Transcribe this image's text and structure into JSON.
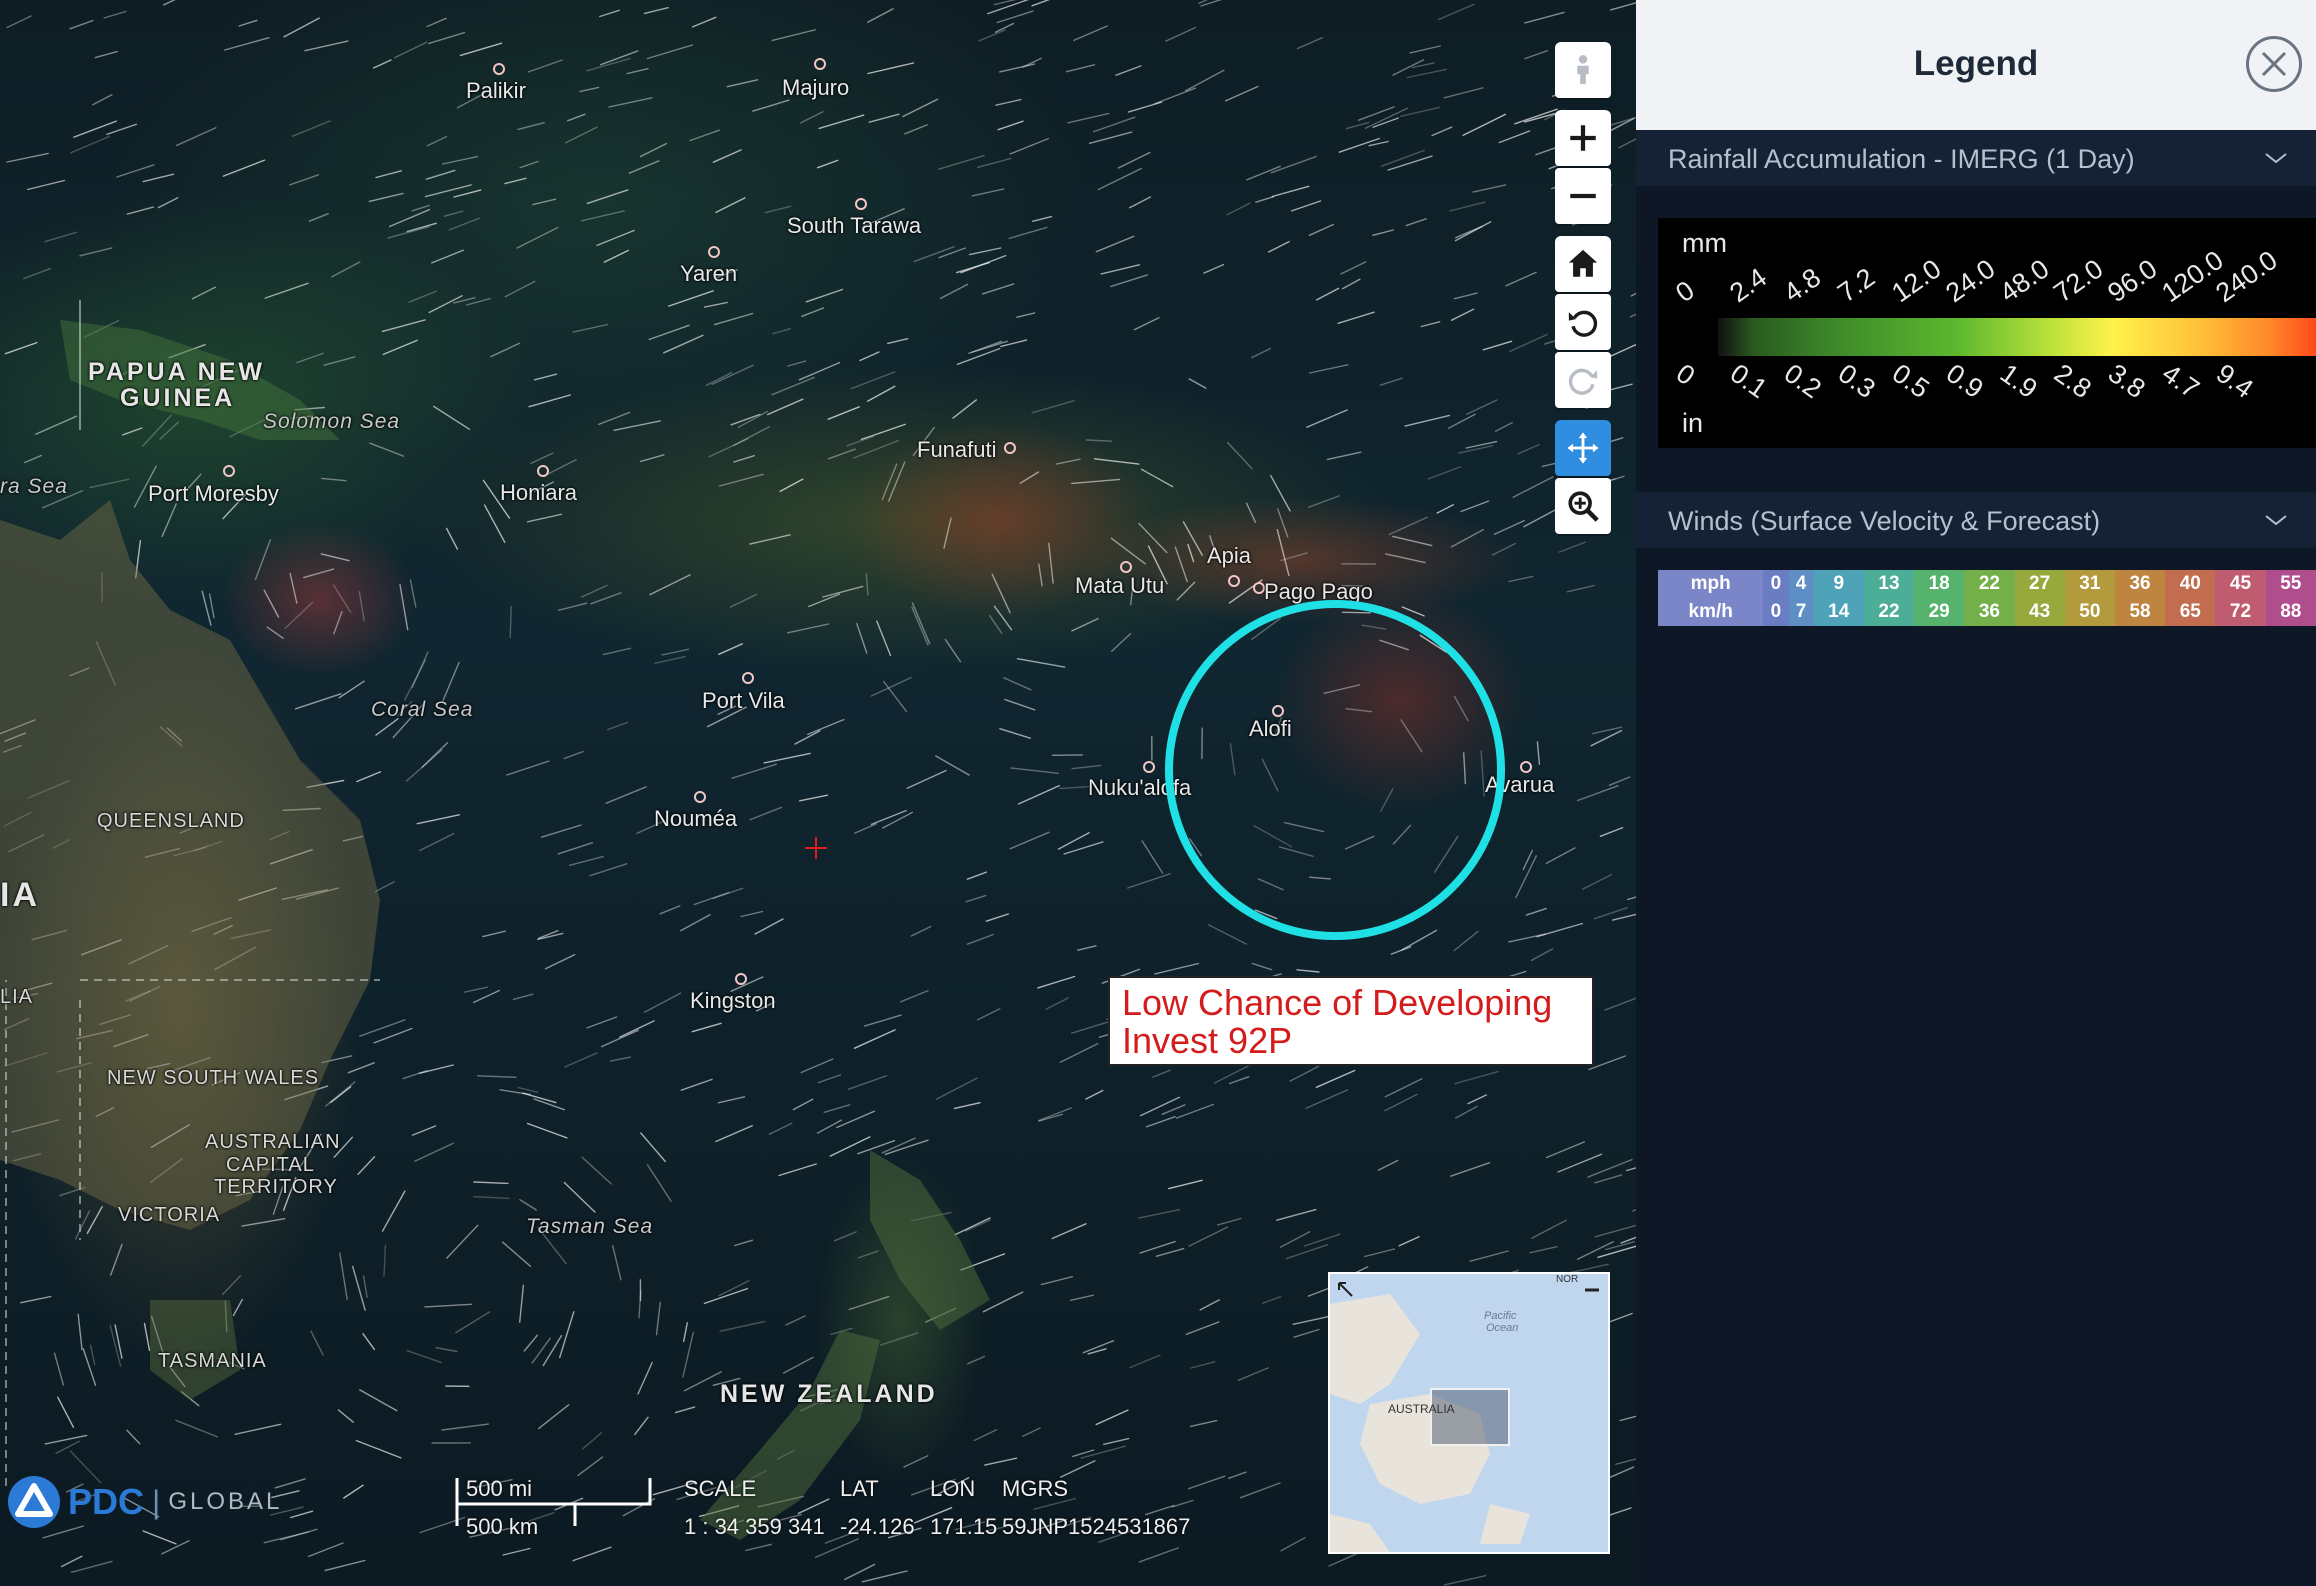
{
  "map": {
    "places": [
      {
        "id": "palikir",
        "label": "Palikir",
        "kind": "city"
      },
      {
        "id": "majuro",
        "label": "Majuro",
        "kind": "city"
      },
      {
        "id": "south-tarawa",
        "label": "South Tarawa",
        "kind": "city"
      },
      {
        "id": "yaren",
        "label": "Yaren",
        "kind": "city"
      },
      {
        "id": "papua",
        "label": "PAPUA NEW",
        "kind": "country"
      },
      {
        "id": "guinea",
        "label": "GUINEA",
        "kind": "country"
      },
      {
        "id": "solomon-sea",
        "label": "Solomon Sea",
        "kind": "sea"
      },
      {
        "id": "port-moresby",
        "label": "Port Moresby",
        "kind": "city"
      },
      {
        "id": "honiara",
        "label": "Honiara",
        "kind": "city"
      },
      {
        "id": "arafura-sea",
        "label": "ra Sea",
        "kind": "sea"
      },
      {
        "id": "funafuti",
        "label": "Funafuti",
        "kind": "city"
      },
      {
        "id": "apia",
        "label": "Apia",
        "kind": "city"
      },
      {
        "id": "mata-utu",
        "label": "Mata Utu",
        "kind": "city"
      },
      {
        "id": "pago-pago",
        "label": "Pago Pago",
        "kind": "city"
      },
      {
        "id": "coral-sea",
        "label": "Coral Sea",
        "kind": "sea"
      },
      {
        "id": "port-vila",
        "label": "Port Vila",
        "kind": "city"
      },
      {
        "id": "alofi",
        "label": "Alofi",
        "kind": "city"
      },
      {
        "id": "nukualofa",
        "label": "Nuku'alofa",
        "kind": "city"
      },
      {
        "id": "avarua",
        "label": "Avarua",
        "kind": "city"
      },
      {
        "id": "queensland",
        "label": "QUEENSLAND",
        "kind": "region"
      },
      {
        "id": "noumea",
        "label": "Nouméa",
        "kind": "city"
      },
      {
        "id": "australia-ia",
        "label": "IA",
        "kind": "country"
      },
      {
        "id": "australia-lia",
        "label": "LIA",
        "kind": "region"
      },
      {
        "id": "kingston",
        "label": "Kingston",
        "kind": "city"
      },
      {
        "id": "nsw",
        "label": "NEW SOUTH WALES",
        "kind": "region"
      },
      {
        "id": "act1",
        "label": "AUSTRALIAN",
        "kind": "region"
      },
      {
        "id": "act2",
        "label": "CAPITAL",
        "kind": "region"
      },
      {
        "id": "act3",
        "label": "TERRITORY",
        "kind": "region"
      },
      {
        "id": "victoria",
        "label": "VICTORIA",
        "kind": "region"
      },
      {
        "id": "tasman-sea",
        "label": "Tasman Sea",
        "kind": "sea"
      },
      {
        "id": "tasmania",
        "label": "TASMANIA",
        "kind": "region"
      },
      {
        "id": "new-zealand",
        "label": "NEW ZEALAND",
        "kind": "country"
      }
    ],
    "annotation": {
      "line1": "Low Chance of Developing",
      "line2": "Invest 92P"
    },
    "logo": {
      "brand": "PDC",
      "suffix": "GLOBAL"
    },
    "scale_bar": {
      "mi": "500 mi",
      "km": "500 km"
    },
    "readout": {
      "scale_label": "SCALE",
      "scale_value": "1 : 34 359 341",
      "lat_label": "LAT",
      "lat_value": "-24.126",
      "lon_label": "LON",
      "lon_value": "171.15",
      "mgrs_label": "MGRS",
      "mgrs_value": "59JNP1524531867"
    },
    "minimap": {
      "label": "AUSTRALIA",
      "ocean1": "Pacific",
      "ocean2": "Ocean",
      "corner": "NOR"
    }
  },
  "toolbar": {
    "icons": [
      "person-icon",
      "zoom-in-icon",
      "zoom-out-icon",
      "home-icon",
      "undo-icon",
      "redo-icon",
      "pan-icon",
      "zoom-box-icon"
    ]
  },
  "legend": {
    "title": "Legend",
    "rain": {
      "title": "Rainfall Accumulation - IMERG (1 Day)",
      "unit_top": "mm",
      "unit_bottom": "in",
      "mm_ticks": [
        "0",
        "2.4",
        "4.8",
        "7.2",
        "12.0",
        "24.0",
        "48.0",
        "72.0",
        "96.0",
        "120.0",
        "240.0"
      ],
      "in_ticks": [
        "0",
        "0.1",
        "0.2",
        "0.3",
        "0.5",
        "0.9",
        "1.9",
        "2.8",
        "3.8",
        "4.7",
        "9.4"
      ]
    },
    "winds": {
      "title": "Winds (Surface Velocity & Forecast)",
      "mph_label": "mph",
      "kmh_label": "km/h",
      "mph": [
        "0",
        "4",
        "9",
        "13",
        "18",
        "22",
        "27",
        "31",
        "36",
        "40",
        "45",
        "55"
      ],
      "kmh": [
        "0",
        "7",
        "14",
        "22",
        "29",
        "36",
        "43",
        "50",
        "58",
        "65",
        "72",
        "88"
      ],
      "colors": [
        "#6a7cc4",
        "#5d8fc4",
        "#4fa3b8",
        "#4cae96",
        "#56b36e",
        "#73b04a",
        "#97a83c",
        "#b39a3c",
        "#bd8540",
        "#c26d4f",
        "#c05c70",
        "#b04d8c"
      ]
    }
  }
}
